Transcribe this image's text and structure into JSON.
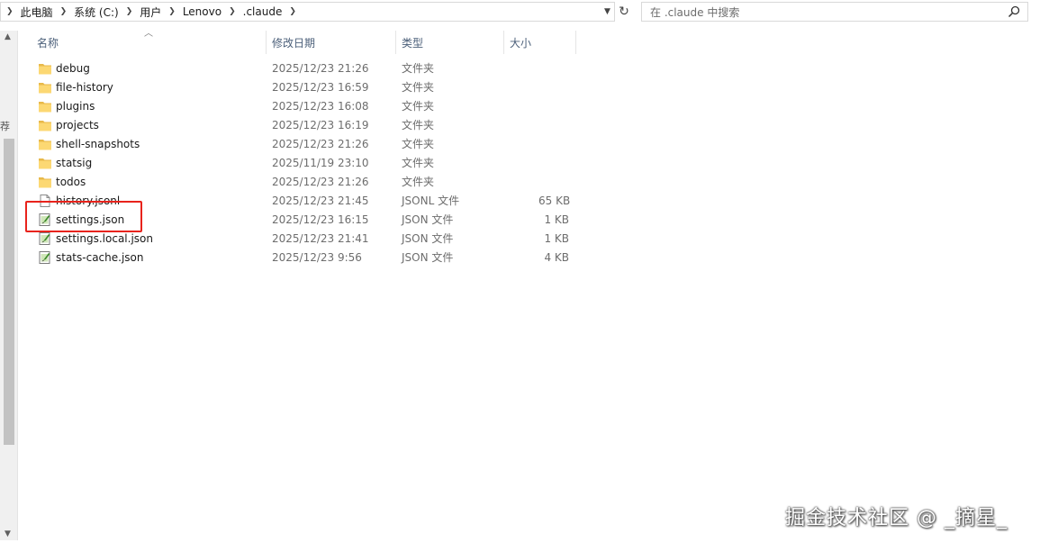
{
  "breadcrumb": [
    "此电脑",
    "系统 (C:)",
    "用户",
    "Lenovo",
    ".claude"
  ],
  "search": {
    "placeholder": "在 .claude 中搜索"
  },
  "columns": {
    "name": "名称",
    "date": "修改日期",
    "type": "类型",
    "size": "大小"
  },
  "nav_peek": "荐",
  "files": [
    {
      "name": "debug",
      "date": "2025/12/23 21:26",
      "type": "文件夹",
      "size": "",
      "icon": "folder-icon"
    },
    {
      "name": "file-history",
      "date": "2025/12/23 16:59",
      "type": "文件夹",
      "size": "",
      "icon": "folder-icon"
    },
    {
      "name": "plugins",
      "date": "2025/12/23 16:08",
      "type": "文件夹",
      "size": "",
      "icon": "folder-icon"
    },
    {
      "name": "projects",
      "date": "2025/12/23 16:19",
      "type": "文件夹",
      "size": "",
      "icon": "folder-icon"
    },
    {
      "name": "shell-snapshots",
      "date": "2025/12/23 21:26",
      "type": "文件夹",
      "size": "",
      "icon": "folder-icon"
    },
    {
      "name": "statsig",
      "date": "2025/11/19 23:10",
      "type": "文件夹",
      "size": "",
      "icon": "folder-icon"
    },
    {
      "name": "todos",
      "date": "2025/12/23 21:26",
      "type": "文件夹",
      "size": "",
      "icon": "folder-icon"
    },
    {
      "name": "history.jsonl",
      "date": "2025/12/23 21:45",
      "type": "JSONL 文件",
      "size": "65 KB",
      "icon": "document-icon"
    },
    {
      "name": "settings.json",
      "date": "2025/12/23 16:15",
      "type": "JSON 文件",
      "size": "1 KB",
      "icon": "json-file-icon"
    },
    {
      "name": "settings.local.json",
      "date": "2025/12/23 21:41",
      "type": "JSON 文件",
      "size": "1 KB",
      "icon": "json-file-icon"
    },
    {
      "name": "stats-cache.json",
      "date": "2025/12/23 9:56",
      "type": "JSON 文件",
      "size": "4 KB",
      "icon": "json-file-icon"
    }
  ],
  "highlighted_file": "settings.json",
  "highlight_color": "#e8231c",
  "watermark": "掘金技术社区 @ _摘星_"
}
